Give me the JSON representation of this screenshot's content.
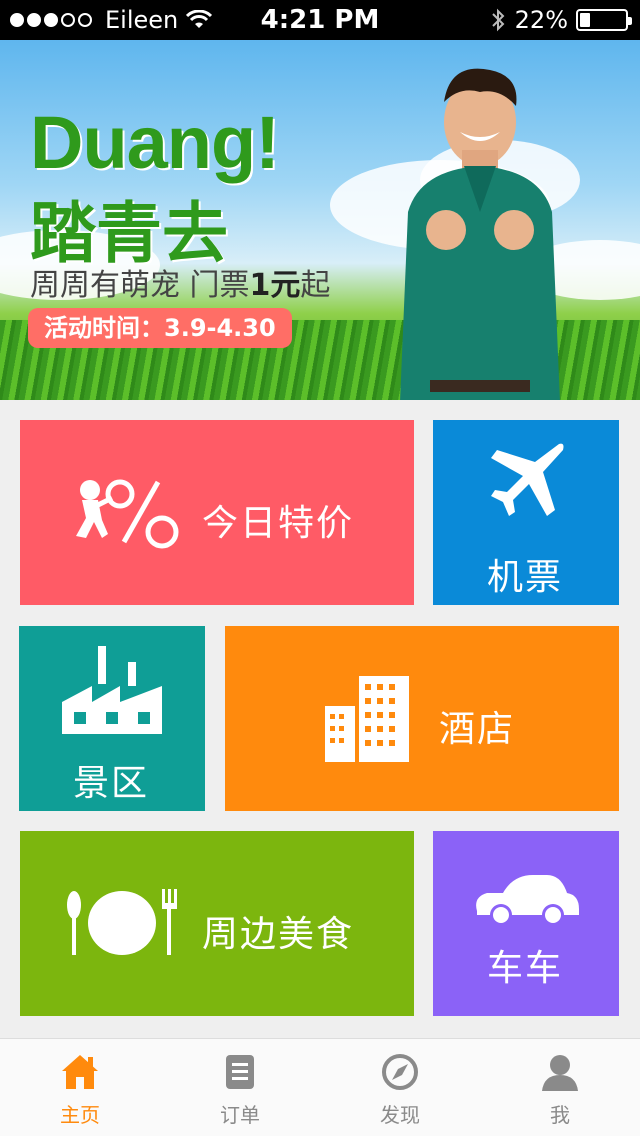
{
  "status_bar": {
    "carrier": "Eileen",
    "time": "4:21 PM",
    "battery": "22%",
    "battery_level": 0.22
  },
  "banner": {
    "title": "Duang!",
    "headline": "踏青去",
    "subtitle_prefix": "周周有萌宠  门票",
    "subtitle_price": "1元",
    "subtitle_suffix": "起",
    "date_label": "活动时间：3.9-4.30"
  },
  "tiles": {
    "deal": {
      "label": "今日特价",
      "color": "#ff5b66"
    },
    "flight": {
      "label": "机票",
      "color": "#0a8ad8"
    },
    "scenic": {
      "label": "景区",
      "color": "#0f9e96"
    },
    "hotel": {
      "label": "酒店",
      "color": "#ff8a0d"
    },
    "food": {
      "label": "周边美食",
      "color": "#7cb60e"
    },
    "car": {
      "label": "车车",
      "color": "#8b62f7"
    }
  },
  "tabbar": {
    "active_color": "#ff8a0d",
    "items": [
      {
        "label": "主页",
        "icon": "home-icon"
      },
      {
        "label": "订单",
        "icon": "order-icon"
      },
      {
        "label": "发现",
        "icon": "compass-icon"
      },
      {
        "label": "我",
        "icon": "user-icon"
      }
    ]
  }
}
